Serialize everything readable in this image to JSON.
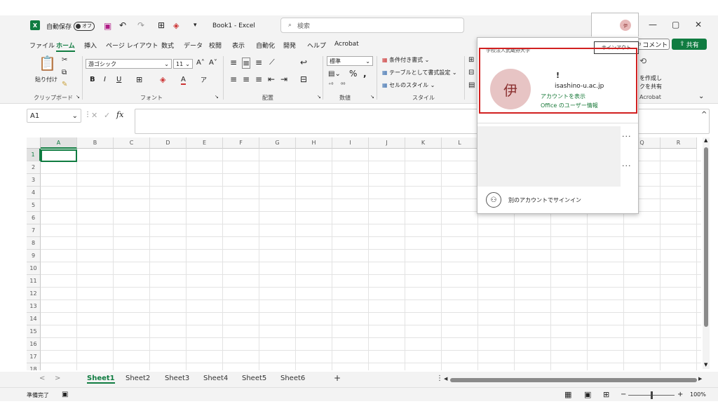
{
  "titlebar": {
    "autosave_label": "自動保存",
    "autosave_state": "オフ",
    "file_title": "Book1 - Excel",
    "search_placeholder": "検索",
    "avatar_initial": "伊"
  },
  "ribbon_tabs": [
    "ファイル",
    "ホーム",
    "挿入",
    "ページ レイアウト",
    "数式",
    "データ",
    "校閲",
    "表示",
    "自動化",
    "開発",
    "ヘルプ",
    "Acrobat"
  ],
  "ribbon_actions": {
    "comment": "コメント",
    "share": "共有"
  },
  "ribbon": {
    "clipboard": {
      "paste": "貼り付け",
      "label": "クリップボード"
    },
    "font": {
      "name": "游ゴシック",
      "size": "11",
      "label": "フォント"
    },
    "alignment": {
      "label": "配置"
    },
    "number": {
      "format": "標準",
      "label": "数値"
    },
    "styles": {
      "conditional": "条件付き書式",
      "table": "テーブルとして書式設定",
      "cell": "セルのスタイル",
      "label": "スタイル"
    },
    "acrobat": {
      "line1": "を作成し",
      "line2": "クを共有",
      "label": "Acrobat"
    }
  },
  "formula_bar": {
    "name_box": "A1",
    "fx": "fx"
  },
  "grid": {
    "columns": [
      "A",
      "B",
      "C",
      "D",
      "E",
      "F",
      "G",
      "H",
      "I",
      "J",
      "K",
      "L",
      "M",
      "N",
      "O",
      "P",
      "Q",
      "R"
    ],
    "rows": [
      "1",
      "2",
      "3",
      "4",
      "5",
      "6",
      "7",
      "8",
      "9",
      "10",
      "11",
      "12",
      "13",
      "14",
      "15",
      "16",
      "17",
      "18"
    ]
  },
  "sheets": [
    "Sheet1",
    "Sheet2",
    "Sheet3",
    "Sheet4",
    "Sheet5",
    "Sheet6"
  ],
  "active_sheet": "Sheet1",
  "status": {
    "ready": "準備完了",
    "zoom": "100%"
  },
  "account_popup": {
    "organization": "学校法人武蔵野大学",
    "signout": "サインアウト",
    "avatar": "伊",
    "name": "!",
    "email": "isashino-u.ac.jp",
    "view_account": "アカウントを表示",
    "office_user_info": "Office のユーザー情報",
    "other_account": "別のアカウントでサインイン"
  }
}
